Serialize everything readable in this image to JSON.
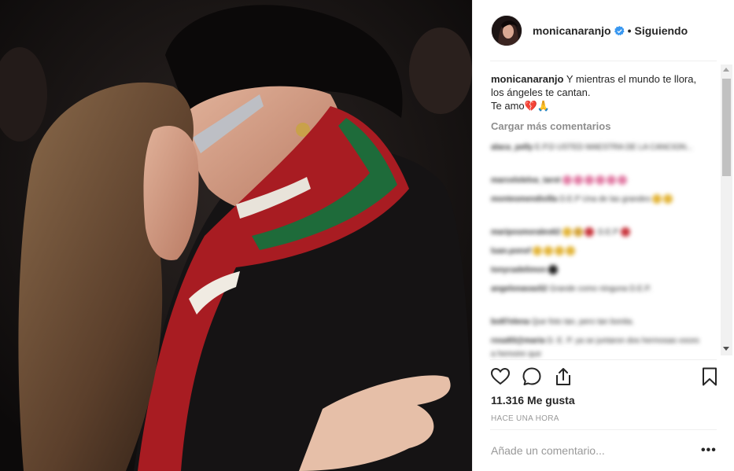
{
  "post": {
    "username": "monicanaranjo",
    "follow_status": "Siguiendo",
    "separator": "•",
    "caption_user": "monicanaranjo",
    "caption_text": "Y mientras el mundo te llora, los ángeles te cantan.",
    "caption_line2": "Te amo💔🙏",
    "load_more": "Cargar más comentarios",
    "likes": "11.316 Me gusta",
    "time_ago": "HACE UNA HORA",
    "add_comment_placeholder": "Añade un comentario...",
    "more_options": "•••"
  },
  "comments": [
    {
      "user": "alaca_pelly",
      "text": "E.P.D USTED MAESTRA DE LA CANCION..."
    },
    {
      "user": "marcelolelva_tarot",
      "text": ""
    },
    {
      "user": "montesmendivilla",
      "text": "D.E.P Una de las grandes"
    },
    {
      "user": "mariposmorales62",
      "text": "D.E.P"
    },
    {
      "user": "luan.ponsf",
      "text": ""
    },
    {
      "user": "tonycadelimon",
      "text": ""
    },
    {
      "user": "angelonavas52",
      "text": "Grande como ninguna D.E.P."
    },
    {
      "user": "bo87elena",
      "text": "Que foto tan, pero tan bonita."
    },
    {
      "user": "rosa93@maria",
      "text": "D. E. P. ya se juntaron dos hermosas voces a hemoire que"
    }
  ],
  "colors": {
    "verified_blue": "#3897f0",
    "secondary_text": "#8e8e8e",
    "divider": "#efefef"
  },
  "icons": [
    "heart-icon",
    "comment-icon",
    "share-icon",
    "bookmark-icon",
    "verified-badge-icon"
  ]
}
